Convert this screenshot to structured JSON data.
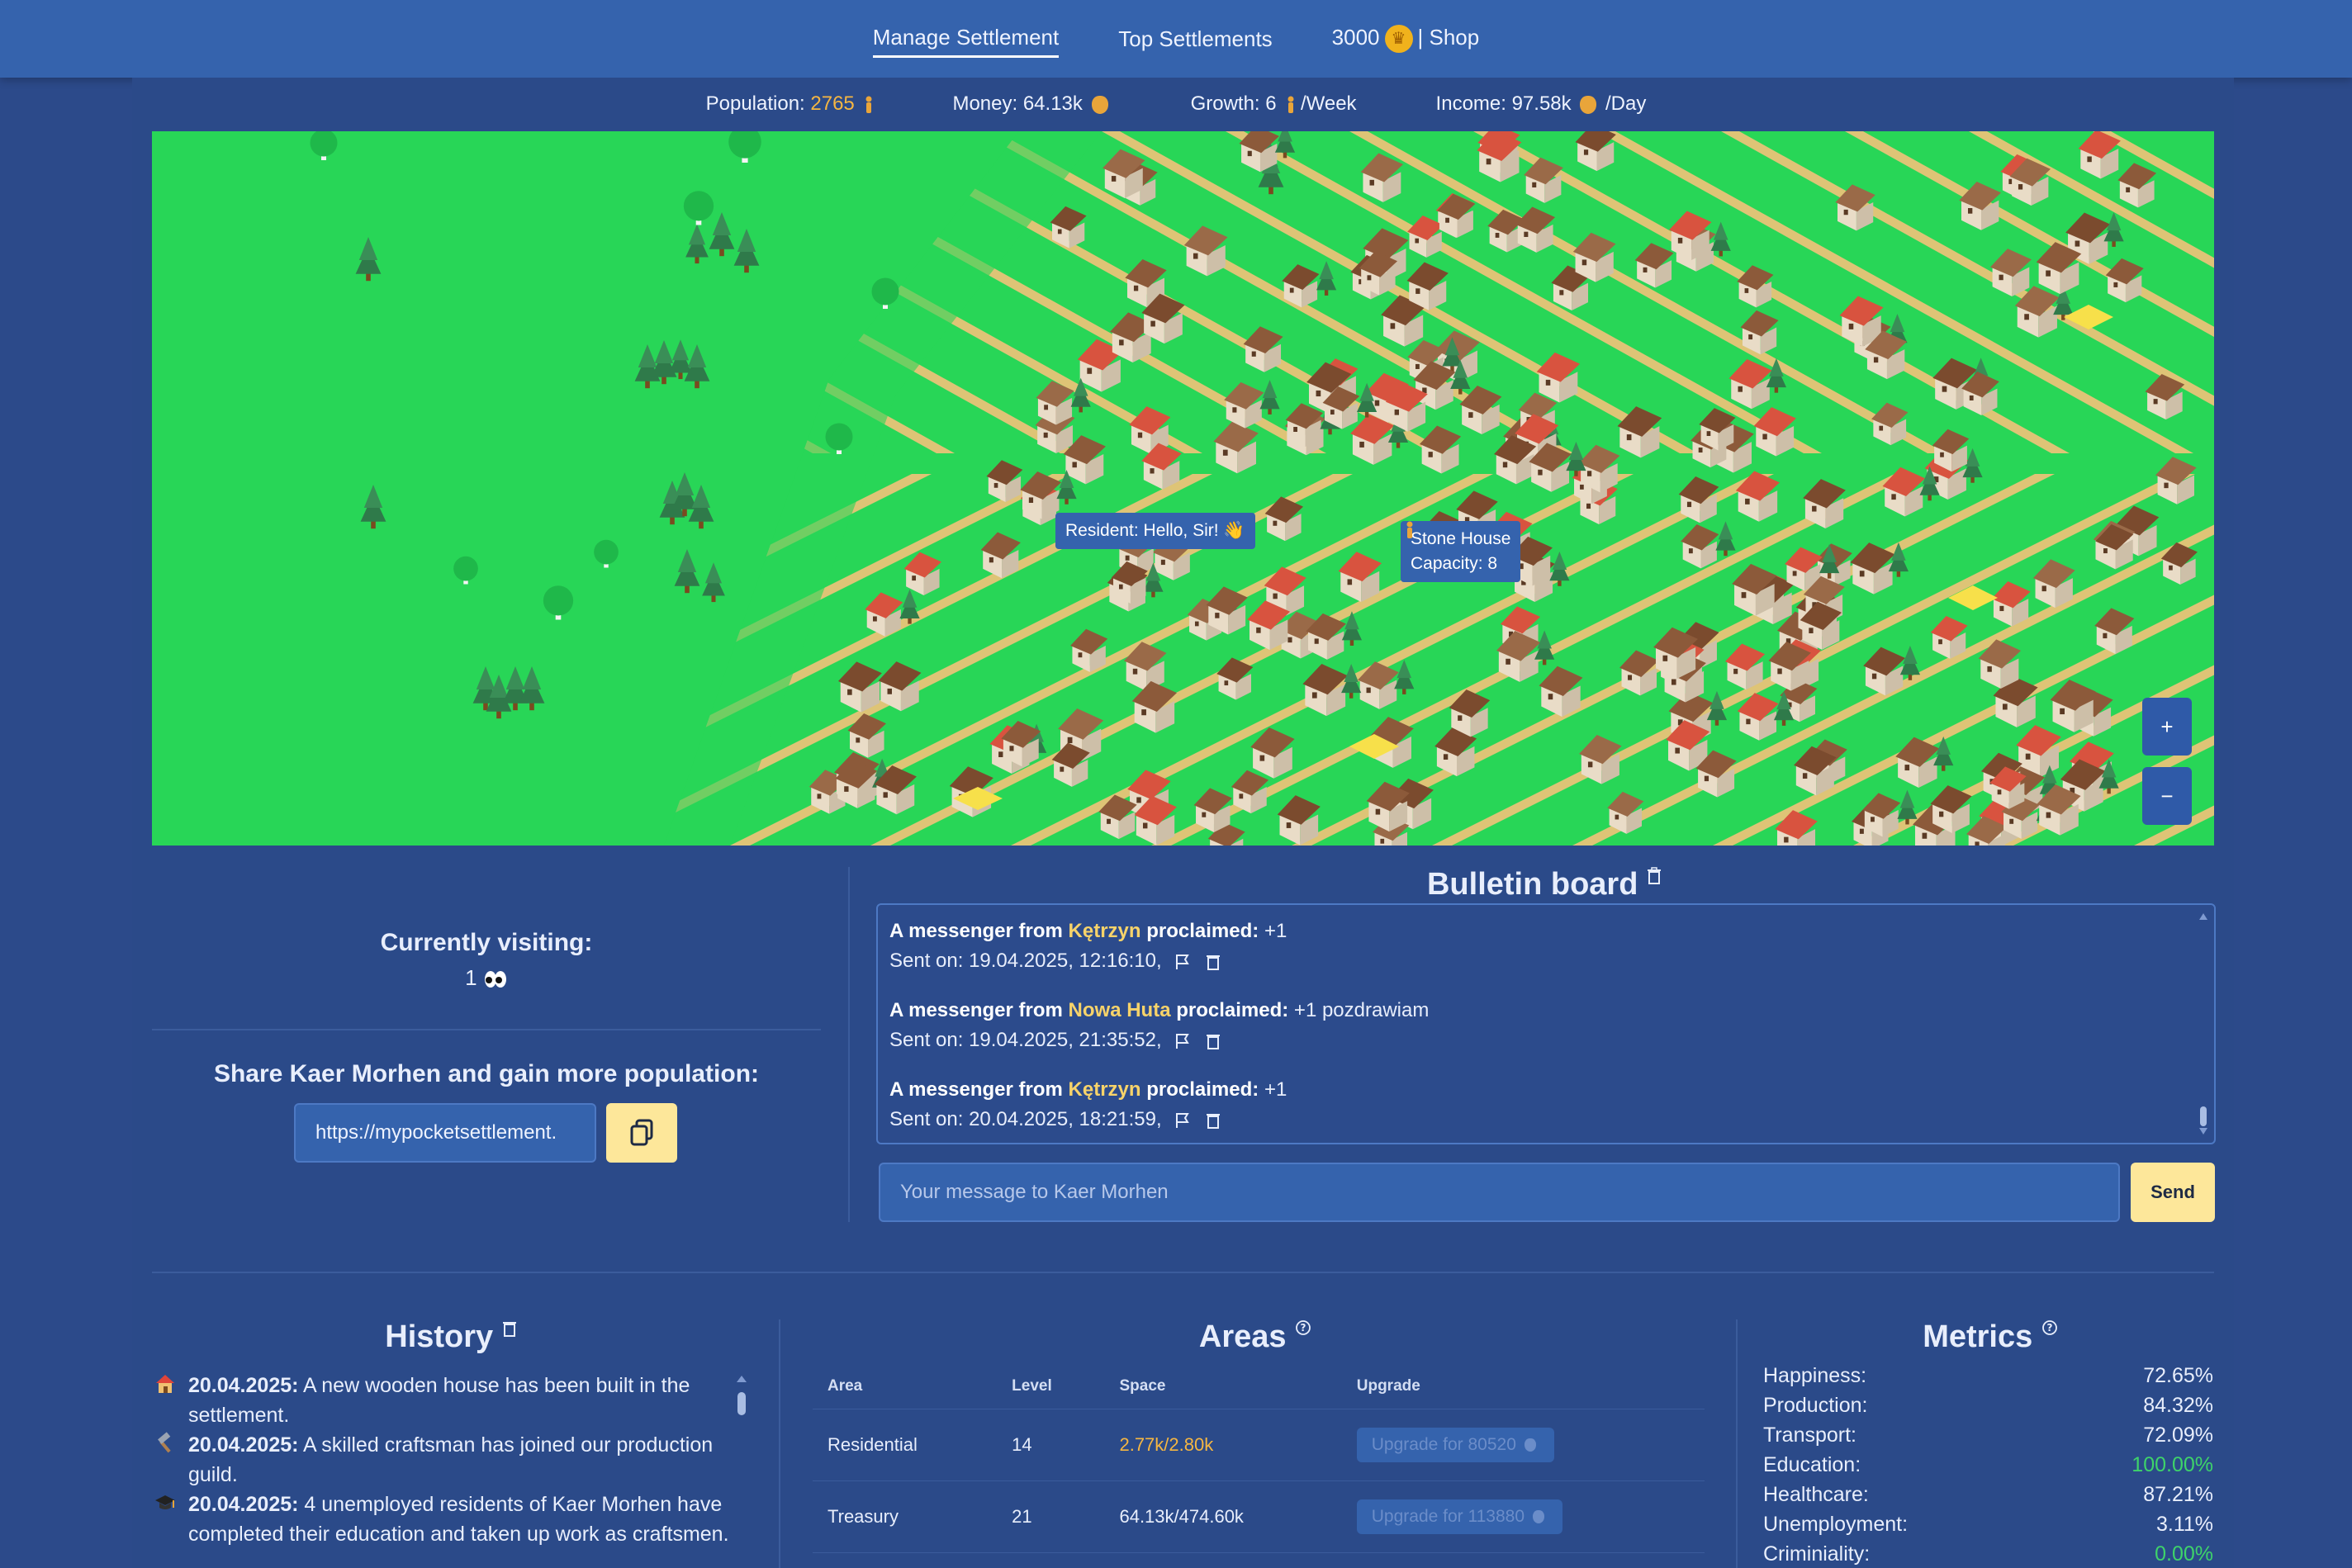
{
  "nav": {
    "manage": "Manage Settlement",
    "top": "Top Settlements",
    "coins": "3000",
    "shop": "| Shop"
  },
  "stats": {
    "population_label": "Population:",
    "population_value": "2765",
    "money_label": "Money: 64.13k",
    "growth_label": "Growth: 6",
    "growth_unit": "/Week",
    "income_label": "Income: 97.58k",
    "income_unit": "/Day"
  },
  "map": {
    "tooltip_resident": "Resident: Hello, Sir! 👋",
    "tooltip_building_name": "Stone House",
    "tooltip_capacity": "Capacity: 8",
    "zoom_in": "+",
    "zoom_out": "−"
  },
  "visiting": {
    "label": "Currently visiting:",
    "count": "1"
  },
  "share": {
    "title": "Share Kaer Morhen and gain more population:",
    "url": "https://mypocketsettlement."
  },
  "bulletin": {
    "title": "Bulletin board",
    "messages": [
      {
        "prefix": "A messenger from",
        "town": "Kętrzyn",
        "verb": "proclaimed:",
        "text": "+1",
        "sent": "Sent on: 19.04.2025, 12:16:10,"
      },
      {
        "prefix": "A messenger from",
        "town": "Nowa Huta",
        "verb": "proclaimed:",
        "text": "+1 pozdrawiam",
        "sent": "Sent on: 19.04.2025, 21:35:52,"
      },
      {
        "prefix": "A messenger from",
        "town": "Kętrzyn",
        "verb": "proclaimed:",
        "text": "+1",
        "sent": "Sent on: 20.04.2025, 18:21:59,"
      }
    ],
    "input_placeholder": "Your message to Kaer Morhen",
    "send": "Send"
  },
  "history": {
    "title": "History",
    "items": [
      {
        "icon": "house-icon",
        "date": "20.04.2025:",
        "text": "A new wooden house has been built in the settlement."
      },
      {
        "icon": "hammer-icon",
        "date": "20.04.2025:",
        "text": "A skilled craftsman has joined our production guild."
      },
      {
        "icon": "graduation-cap-icon",
        "date": "20.04.2025:",
        "text": "4 unemployed residents of Kaer Morhen have completed their education and taken up work as craftsmen."
      }
    ]
  },
  "areas": {
    "title": "Areas",
    "headers": [
      "Area",
      "Level",
      "Space",
      "Upgrade"
    ],
    "rows": [
      {
        "area": "Residential",
        "level": "14",
        "space": "2.77k/2.80k",
        "upgrade": "Upgrade for 80520"
      },
      {
        "area": "Treasury",
        "level": "21",
        "space": "64.13k/474.60k",
        "upgrade": "Upgrade for 113880"
      }
    ]
  },
  "metrics": {
    "title": "Metrics",
    "items": [
      {
        "label": "Happiness:",
        "value": "72.65%"
      },
      {
        "label": "Production:",
        "value": "84.32%"
      },
      {
        "label": "Transport:",
        "value": "72.09%"
      },
      {
        "label": "Education:",
        "value": "100.00%"
      },
      {
        "label": "Healthcare:",
        "value": "87.21%"
      },
      {
        "label": "Unemployment:",
        "value": "3.11%"
      },
      {
        "label": "Criminiality:",
        "value": "0.00%"
      }
    ]
  },
  "colors": {
    "nav_bg": "#3563ad",
    "page_bg": "#2c4a8a",
    "grass": "#28d657",
    "accent_yellow": "#fde79a",
    "highlight_orange": "#f5b642",
    "positive_green": "#3ed36a"
  }
}
